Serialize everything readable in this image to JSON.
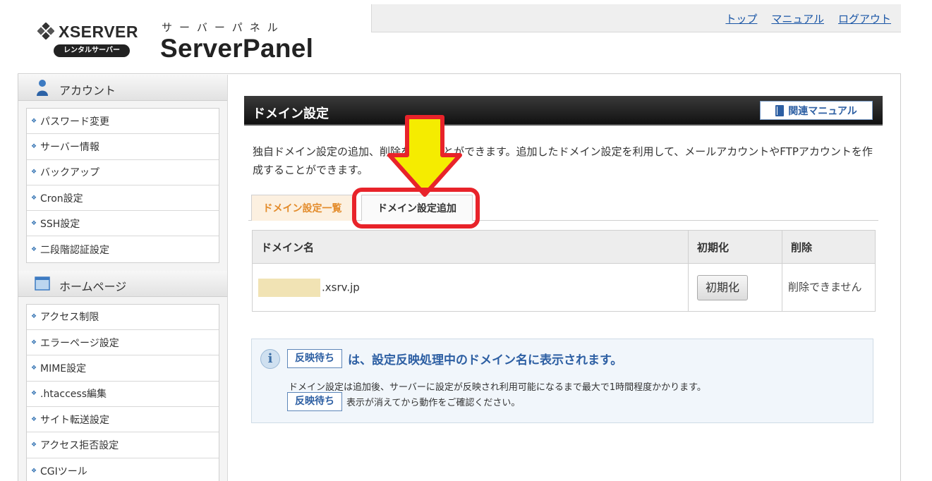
{
  "header": {
    "brand": "XSERVER",
    "brand_sub": "レンタルサーバー",
    "panel_kana": "サーバーパネル",
    "panel_name": "ServerPanel",
    "links": [
      "トップ",
      "マニュアル",
      "ログアウト"
    ]
  },
  "sidebar": {
    "sections": [
      {
        "title": "アカウント",
        "icon": "user-icon",
        "items": [
          "パスワード変更",
          "サーバー情報",
          "バックアップ",
          "Cron設定",
          "SSH設定",
          "二段階認証設定"
        ]
      },
      {
        "title": "ホームページ",
        "icon": "window-icon",
        "items": [
          "アクセス制限",
          "エラーページ設定",
          "MIME設定",
          ".htaccess編集",
          "サイト転送設定",
          "アクセス拒否設定",
          "CGIツール"
        ]
      }
    ]
  },
  "main": {
    "title": "ドメイン設定",
    "manual_button": "関連マニュアル",
    "description": "独自ドメイン設定の追加、削除を行うことができます。追加したドメイン設定を利用して、メールアカウントやFTPアカウントを作成することができます。",
    "tabs": [
      "ドメイン設定一覧",
      "ドメイン設定追加"
    ],
    "table": {
      "headers": [
        "ドメイン名",
        "初期化",
        "削除"
      ],
      "rows": [
        {
          "domain_suffix": ".xsrv.jp",
          "init_button": "初期化",
          "delete_text": "削除できません"
        }
      ]
    },
    "info": {
      "badge": "反映待ち",
      "headline": "は、設定反映処理中のドメイン名に表示されます。",
      "line1": "ドメイン設定は追加後、サーバーに設定が反映され利用可能になるまで最大で1時間程度かかります。",
      "line2": "表示が消えてから動作をご確認ください。"
    }
  },
  "colors": {
    "link": "#1a56a6",
    "accent_orange": "#e38b2a",
    "annotation_red": "#e8232a",
    "annotation_yellow": "#f5ec00"
  }
}
